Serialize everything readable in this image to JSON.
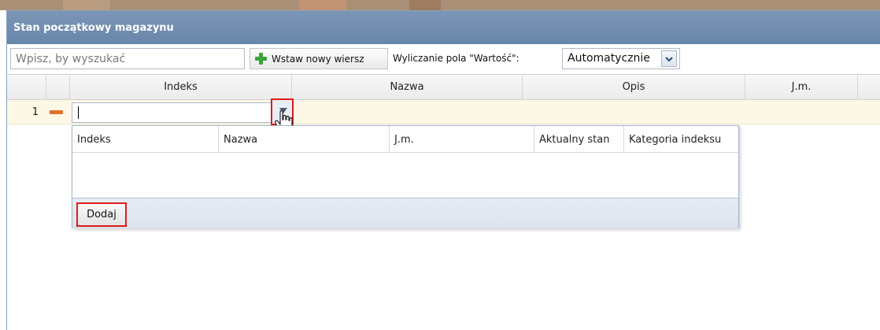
{
  "window": {
    "title": "Stan początkowy magazynu"
  },
  "toolbar": {
    "search_placeholder": "Wpisz, by wyszukać",
    "insert_label": "Wstaw nowy wiersz",
    "calc_label": "Wyliczanie pola \"Wartość\":",
    "calc_value": "Automatycznie"
  },
  "grid": {
    "columns": [
      "Indeks",
      "Nazwa",
      "Opis",
      "J.m."
    ],
    "rows": [
      {
        "number": "1",
        "indeks_value": ""
      }
    ]
  },
  "dropdown": {
    "columns": [
      "Indeks",
      "Nazwa",
      "J.m.",
      "Aktualny stan",
      "Kategoria indeksu"
    ],
    "add_label": "Dodaj"
  },
  "colors": {
    "title_bar": "#6f8aae",
    "highlight": "#e01b1b",
    "row_bg": "#fdf8e5",
    "plus": "#3aa33a",
    "minus": "#e2702a"
  },
  "icons": [
    "plus-icon",
    "chevron-down-icon",
    "minus-icon",
    "dropdown-arrow-icon",
    "hand-cursor-icon"
  ]
}
